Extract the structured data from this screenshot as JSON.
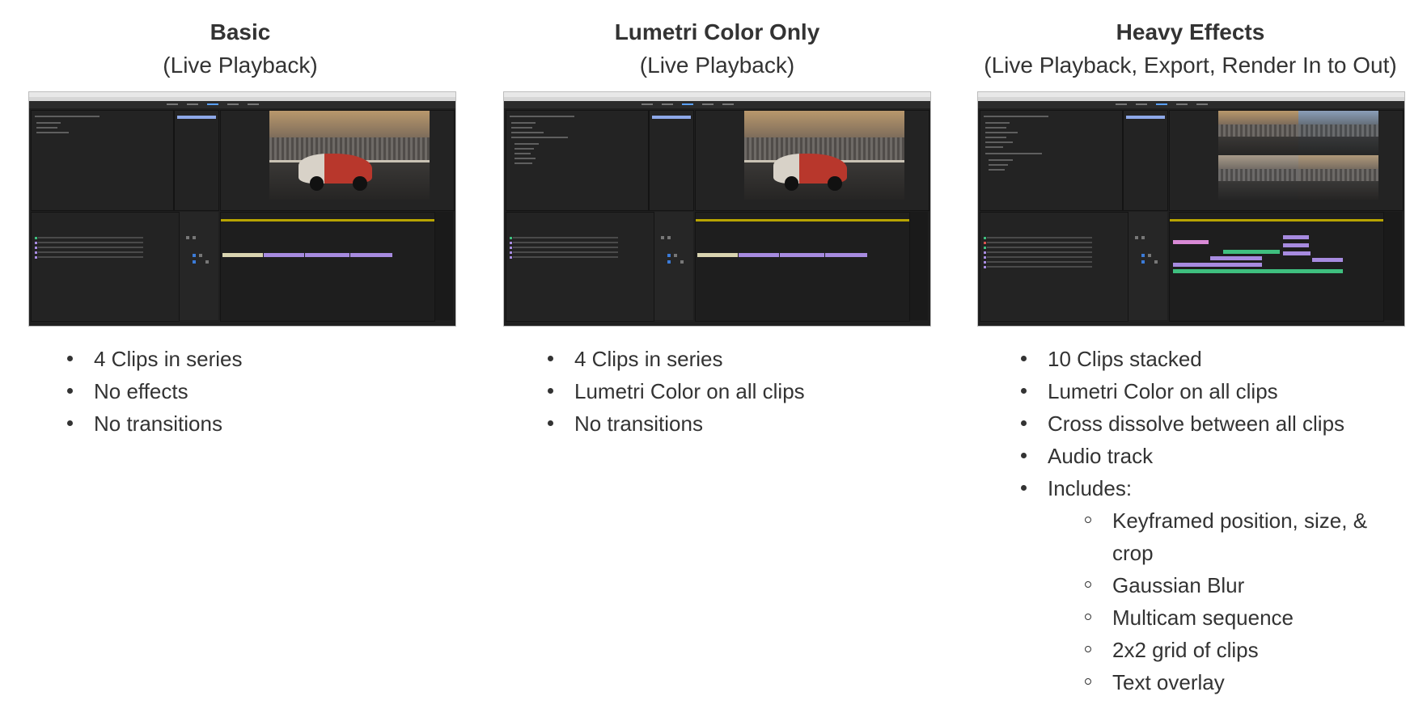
{
  "columns": [
    {
      "title": "Basic",
      "subtitle": "(Live Playback)",
      "screenshot_icon": "premiere-pro-screenshot",
      "points": [
        "4 Clips in series",
        "No effects",
        "No transitions"
      ]
    },
    {
      "title": "Lumetri Color Only",
      "subtitle": "(Live Playback)",
      "screenshot_icon": "premiere-pro-screenshot",
      "points": [
        "4 Clips in series",
        "Lumetri Color on all clips",
        "No transitions"
      ]
    },
    {
      "title": "Heavy Effects",
      "subtitle": "(Live Playback, Export, Render In to Out)",
      "screenshot_icon": "premiere-pro-screenshot-quad",
      "points": [
        "10 Clips stacked",
        "Lumetri Color on all clips",
        "Cross dissolve between all clips",
        "Audio track",
        "Includes:"
      ],
      "subpoints": [
        "Keyframed position, size, & crop",
        "Gaussian Blur",
        "Multicam sequence",
        "2x2 grid of clips",
        "Text overlay"
      ]
    }
  ],
  "colors": {
    "text": "#333333",
    "clip_purple": "#a78be0",
    "clip_green": "#3fbf7f",
    "clip_pink": "#d98ad6",
    "clip_beige": "#d9d4b0"
  }
}
